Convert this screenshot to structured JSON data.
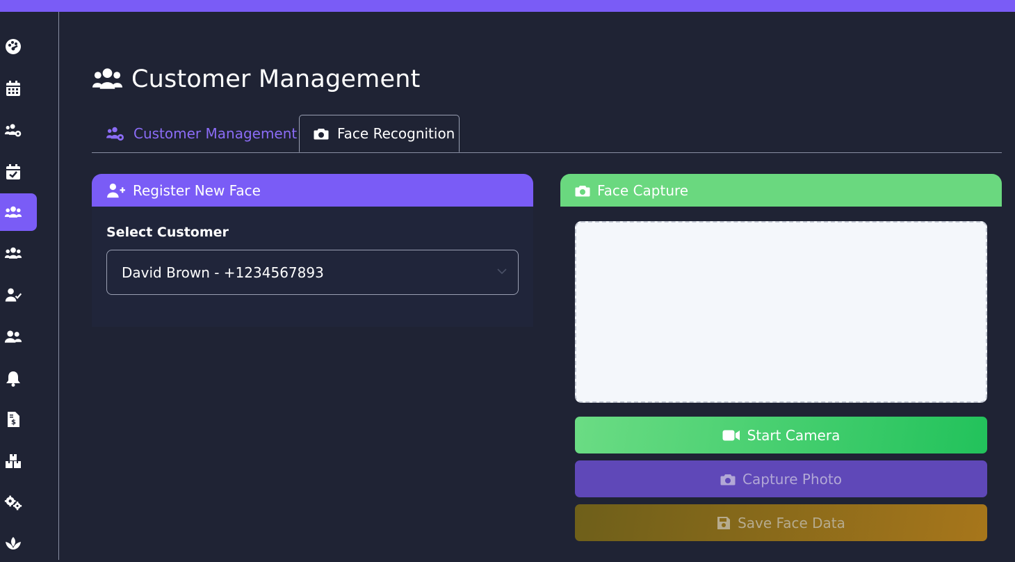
{
  "colors": {
    "accent": "#7a5cf6",
    "background": "#1f2334",
    "success": "#22c25b",
    "warning": "#a7761b"
  },
  "sidebar": {
    "items": [
      {
        "icon": "palette-icon",
        "active": false
      },
      {
        "icon": "calendar-icon",
        "active": false
      },
      {
        "icon": "users-cog-icon",
        "active": false
      },
      {
        "icon": "calendar-check-icon",
        "active": false
      },
      {
        "icon": "users-icon",
        "active": true
      },
      {
        "icon": "users-icon",
        "active": false
      },
      {
        "icon": "user-check-icon",
        "active": false
      },
      {
        "icon": "user-friends-icon",
        "active": false
      },
      {
        "icon": "bell-icon",
        "active": false
      },
      {
        "icon": "file-invoice-dollar-icon",
        "active": false
      },
      {
        "icon": "boxes-icon",
        "active": false
      },
      {
        "icon": "cogs-icon",
        "active": false
      },
      {
        "icon": "spa-icon",
        "active": false
      }
    ]
  },
  "page": {
    "title": "Customer Management",
    "title_icon": "users-icon"
  },
  "tabs": [
    {
      "label": "Customer Management",
      "icon": "users-cog-icon",
      "active": false
    },
    {
      "label": "Face Recognition",
      "icon": "camera-icon",
      "active": true
    }
  ],
  "register": {
    "header": "Register New Face",
    "header_icon": "user-plus-icon",
    "select_label": "Select Customer",
    "selected_customer": "David Brown - +1234567893"
  },
  "capture": {
    "header": "Face Capture",
    "header_icon": "camera-icon",
    "start_label": "Start Camera",
    "start_icon": "video-icon",
    "capture_label": "Capture Photo",
    "capture_icon": "camera-icon",
    "save_label": "Save Face Data",
    "save_icon": "save-icon"
  }
}
